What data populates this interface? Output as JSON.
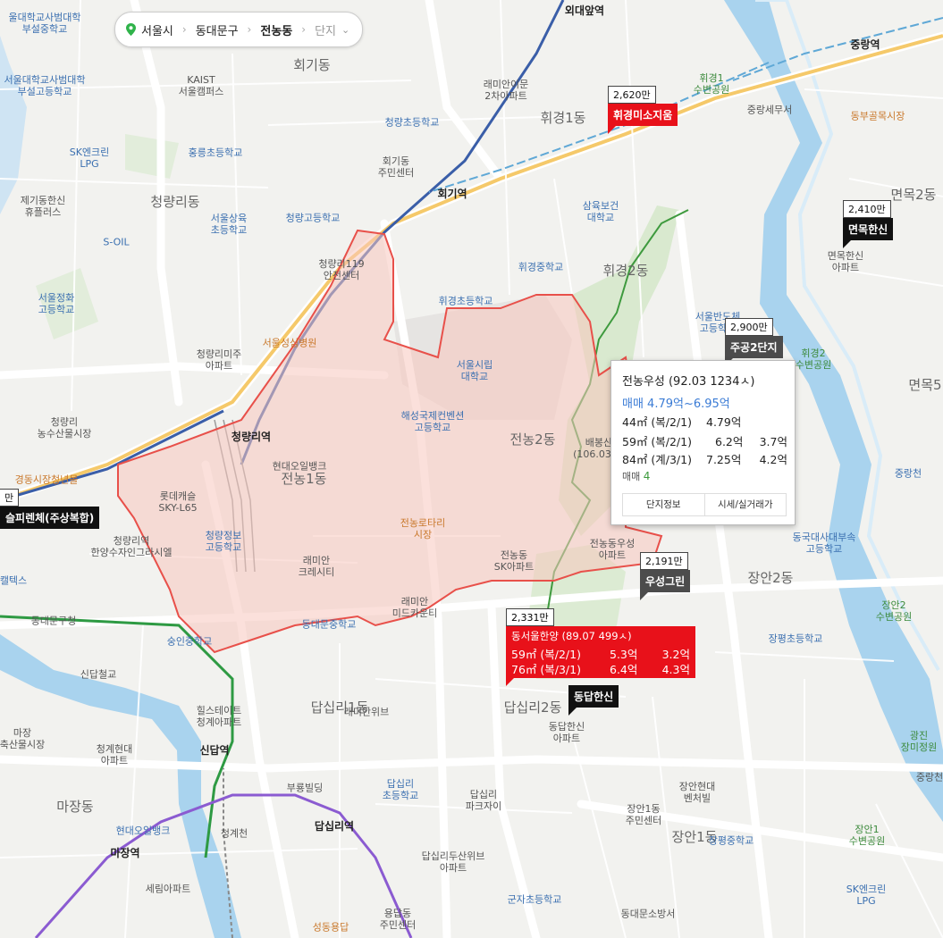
{
  "breadcrumb": {
    "pin_icon": "location-pin-icon",
    "city": "서울시",
    "district": "동대문구",
    "dong": "전농동",
    "complex": "단지"
  },
  "colors": {
    "red": "#e8111a",
    "black": "#111111",
    "gray": "#4c4c4c",
    "area_fill": "#f8d3cc",
    "area_border": "#e8504a",
    "river": "#a9d3ee",
    "link": "#3a7bd5"
  },
  "markers": [
    {
      "id": "hwigyeong-misojiwoom",
      "price": "2,620만",
      "name": "휘경미소지움",
      "style": "red"
    },
    {
      "id": "myeonmok-hansin",
      "price": "2,410만",
      "name": "면목한신",
      "style": "black"
    },
    {
      "id": "jugong2",
      "price": "2,900만",
      "name": "주공2단지",
      "style": "gray"
    },
    {
      "id": "woosung-green",
      "price": "2,191만",
      "name": "우성그린",
      "style": "gray"
    },
    {
      "id": "dapsimni-hansin",
      "price": "",
      "name": "동답한신",
      "style": "black"
    },
    {
      "id": "left-cut",
      "price": "만",
      "name": "슬피렌체(주상복합)",
      "style": "black"
    }
  ],
  "popup": {
    "title": "전농우성 (92.03 1234ㅅ)",
    "range": "매매 4.79억~6.95억",
    "rows": [
      {
        "size": "44㎡ (복/2/1)",
        "sale": "4.79억",
        "lease": ""
      },
      {
        "size": "59㎡ (복/2/1)",
        "sale": "6.2억",
        "lease": "3.7억"
      },
      {
        "size": "84㎡ (계/3/1)",
        "sale": "7.25억",
        "lease": "4.2억"
      }
    ],
    "count_label": "매매",
    "count": "4",
    "btn_info": "단지정보",
    "btn_price": "시세/실거래가"
  },
  "big_marker": {
    "price": "2,331만",
    "title": "동서울한양 (89.07 499ㅅ)",
    "rows": [
      {
        "size": "59㎡ (복/2/1)",
        "sale": "5.3억",
        "lease": "3.2억"
      },
      {
        "size": "76㎡ (복/3/1)",
        "sale": "6.4억",
        "lease": "4.3억"
      }
    ]
  },
  "map_labels": {
    "dongs": [
      "회기동",
      "휘경1동",
      "휘경2동",
      "청량리동",
      "전농1동",
      "전농2동",
      "답십리1동",
      "답십리2동",
      "장안2동",
      "장안1동",
      "마장동",
      "면목2동",
      "면목5"
    ],
    "stations": [
      "외대앞역",
      "회기역",
      "청량리역",
      "신답역",
      "답십리역",
      "마장역",
      "중랑역"
    ],
    "pois": [
      "울대학교사범대학\n부설중학교",
      "서울대학교사범대학\n부설고등학교",
      "KAIST\n서울캠퍼스",
      "래미안이문\n2차아파트",
      "경희대학교",
      "청량초등학교",
      "회기동\n주민센터",
      "휘경1\n수변공원",
      "중랑세무서",
      "동부골목시장",
      "SK엔크린\nLPG",
      "홍릉초등학교",
      "제기동한신\n휴플러스",
      "서울상육\n초등학교",
      "청량고등학교",
      "삼육보건\n대학교",
      "S-OIL",
      "청량리119\n안전센터",
      "휘경중학교",
      "휘경초등학교",
      "면목한신\n아파트",
      "서울정화\n고등학교",
      "서울성심병원",
      "서울반도체\n고등학교",
      "서울시립\n대학교",
      "청량리미주\n아파트",
      "해성국제컨벤션\n고등학교",
      "휘경2\n수변공원",
      "배봉산\n(106.03m)",
      "청량리\n농수산물시장",
      "현대오일뱅크",
      "경동시장청년몰",
      "롯데캐슬\nSKY-L65",
      "전농로타리\n시장",
      "청량리역\n한양수자인그라시엘",
      "청량정보\n고등학교",
      "래미안\n크레시티",
      "전농동\nSK아파트",
      "전농동우성\n아파트",
      "동국대사대부속\n고등학교",
      "중랑천",
      "장안2\n수변공원",
      "래미안\n미드카운티",
      "동대문중학교",
      "숭인중학교",
      "동대문구청",
      "장평초등학교",
      "신답철교",
      "힐스테이트\n청계아파트",
      "래미안위브",
      "동답한신\n아파트",
      "청계현대\n아파트",
      "부룡빌딩",
      "답십리\n초등학교",
      "장안현대\n벤처빌",
      "장안1동\n주민센터",
      "장평중학교",
      "광진\n장미정원",
      "답십리\n파크자이",
      "장안1\n수변공원",
      "답십리두산위브\n아파트",
      "세림아파트",
      "군자초등학교",
      "용답동\n주민센터",
      "동대문소방서",
      "SK엔크린\nLPG",
      "성동용답",
      "청계천",
      "현대오일뱅크",
      "캘텍스",
      "마장\n축산물시장",
      "중랑천"
    ]
  }
}
